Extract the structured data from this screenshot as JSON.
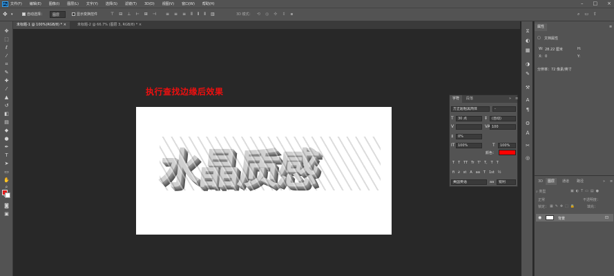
{
  "app": {
    "logo": "Ps"
  },
  "menu": [
    "文件(F)",
    "编辑(E)",
    "图像(I)",
    "图层(L)",
    "文字(Y)",
    "选择(S)",
    "滤镜(T)",
    "3D(D)",
    "视图(V)",
    "窗口(W)",
    "帮助(H)"
  ],
  "options": {
    "auto_select_label": "自动选择：",
    "auto_select_value": "图层",
    "transform_label": "显示变换控件",
    "mode_3d_label": "3D 模式："
  },
  "tabs": [
    {
      "label": "未标题-1 @ 100%(RGB/8) *",
      "close": "×"
    },
    {
      "label": "未标题-2 @ 66.7% (图层 3, RGB/8) *",
      "close": "×"
    }
  ],
  "canvas": {
    "caption": "执行查找边缘后效果",
    "art_text": "水晶质感"
  },
  "character_panel": {
    "tabs": [
      "字符",
      "段落"
    ],
    "font_family": "方正超粗黑简体",
    "font_style": "-",
    "font_size": "30 点",
    "leading": "(自动)",
    "kerning": "",
    "tracking": "100",
    "scale_pct": "0%",
    "vertical_scale": "100%",
    "horizontal_scale": "100%",
    "color_label": "颜色：",
    "color": "#ff0000",
    "style_buttons": [
      "T",
      "T",
      "TT",
      "Tr",
      "T'",
      "T,",
      "T",
      "T"
    ],
    "glyph_buttons": [
      "fi",
      "∂",
      "st",
      "A",
      "aa",
      "T",
      "1st",
      "½"
    ],
    "language": "美国英语",
    "antialias": "锐利"
  },
  "properties_panel": {
    "tab": "属性",
    "title": "文档属性",
    "w_label": "W:",
    "w_value": "28.22 厘米",
    "h_label": "H:",
    "x_label": "X:",
    "x_value": "0",
    "y_label": "Y:",
    "resolution": "分辨率：72 像素/英寸"
  },
  "layers_panel": {
    "tabs": [
      "3D",
      "图层",
      "通道",
      "路径"
    ],
    "search_placeholder": "类型",
    "blend_mode": "正常",
    "opacity_label": "不透明度：",
    "lock_label": "锁定：",
    "fill_label": "填充：",
    "layer_name": "背景"
  },
  "colors": {
    "foreground": "#e01b1b",
    "background": "#ffffff",
    "accent_caption": "#ee0f0f"
  }
}
